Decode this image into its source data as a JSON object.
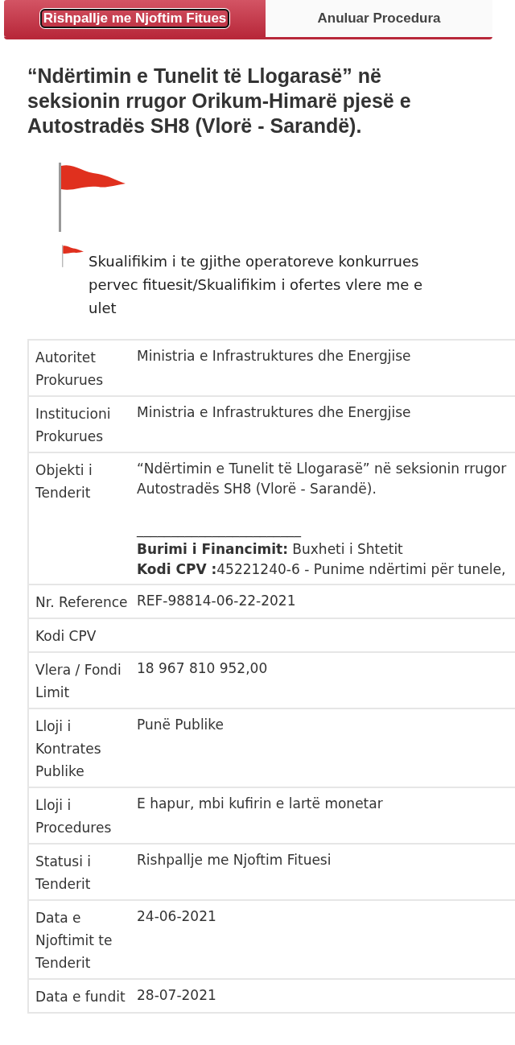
{
  "tabs": [
    {
      "label": "Rishpallje me Njoftim Fitues",
      "selected": true
    },
    {
      "label": "Anuluar Procedura",
      "selected": false
    }
  ],
  "title": "“Ndërtimin e Tunelit të Llogarasë” në seksionin rrugor Orikum-Himarë pjesë e Autostradës SH8 (Vlorë - Sarandë).",
  "flag_note": "Skualifikim i te gjithe operatoreve konkurrues pervec fituesit/Skualifikim i ofertes vlere me e ulet",
  "details": [
    {
      "label": "Autoritet Prokurues",
      "value": [
        "Ministria e Infrastruktures dhe Energjise"
      ]
    },
    {
      "label": "Institucioni Prokurues",
      "value": [
        "Ministria e Infrastruktures dhe Energjise"
      ]
    },
    {
      "label": "Objekti i Tenderit",
      "value": [
        "“Ndërtimin e Tunelit të Llogarasë” në seksionin rrugor",
        "Autostradës SH8 (Vlorë - Sarandë).",
        "________________________",
        "**Burimi i Financimit:** Buxheti i Shtetit",
        "**Kodi CPV :**45221240-6 - Punime ndërtimi për tunele,"
      ]
    },
    {
      "label": "Nr. Reference",
      "value": [
        "REF-98814-06-22-2021"
      ]
    },
    {
      "label": "Kodi CPV"
    },
    {
      "label": "Vlera / Fondi Limit",
      "value": [
        "18 967 810 952,00"
      ]
    },
    {
      "label": "Lloji i Kontrates Publike",
      "value": [
        "Punë Publike"
      ]
    },
    {
      "label": "Lloji i Procedures",
      "value": [
        "E hapur, mbi kufirin e lartë monetar"
      ]
    },
    {
      "label": "Statusi i Tenderit",
      "value": [
        "Rishpallje me Njoftim Fituesi"
      ]
    },
    {
      "label": "Data e Njoftimit te Tenderit",
      "value": [
        "24-06-2021"
      ]
    },
    {
      "label": "Data e fundit",
      "value": [
        "28-07-2021"
      ]
    }
  ]
}
